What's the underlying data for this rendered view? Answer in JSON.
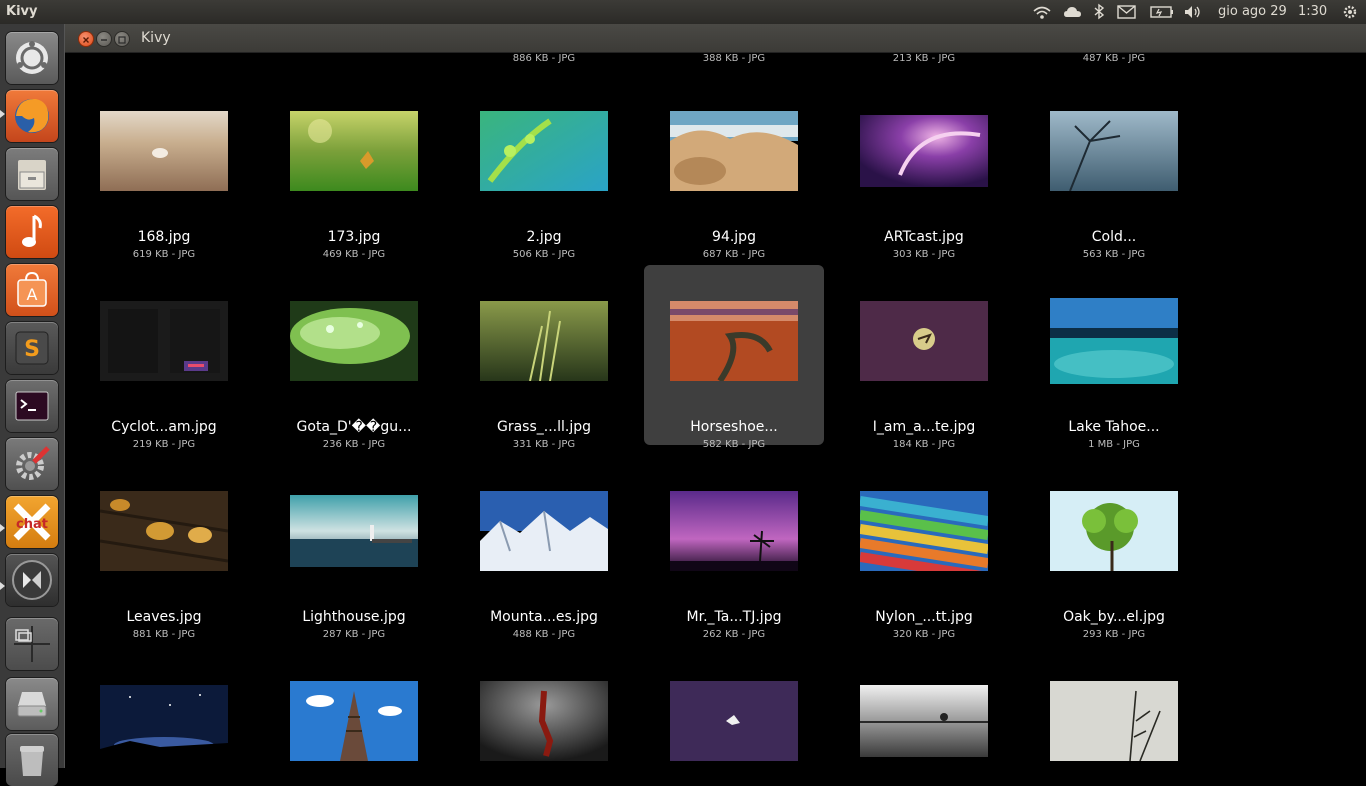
{
  "top_panel": {
    "app_name": "Kivy",
    "date": "gio ago 29",
    "time": "1:30",
    "indicators": [
      "wifi-icon",
      "cloud-icon",
      "bluetooth-icon",
      "mail-icon",
      "battery-icon",
      "volume-icon",
      "gear-icon"
    ]
  },
  "launcher": {
    "items": [
      "ubuntu-logo-icon",
      "firefox-icon",
      "file-manager-icon",
      "music-player-icon",
      "software-center-icon",
      "sublime-text-icon",
      "terminal-icon",
      "system-settings-icon",
      "chat-app-icon",
      "kivy-icon",
      "workspace-switcher-icon",
      "disk-drive-icon",
      "trash-icon"
    ]
  },
  "window": {
    "title": "Kivy"
  },
  "previous_row_meta": [
    "886 KB - JPG",
    "388 KB - JPG",
    "213 KB - JPG",
    "487 KB - JPG"
  ],
  "rows": [
    [
      {
        "name": "168.jpg",
        "meta": "619 KB - JPG"
      },
      {
        "name": "173.jpg",
        "meta": "469 KB - JPG"
      },
      {
        "name": "2.jpg",
        "meta": "506 KB - JPG"
      },
      {
        "name": "94.jpg",
        "meta": "687 KB - JPG"
      },
      {
        "name": "ARTcast.jpg",
        "meta": "303 KB - JPG"
      },
      {
        "name": "Cold...",
        "meta": "563 KB - JPG"
      }
    ],
    [
      {
        "name": "Cyclot...am.jpg",
        "meta": "219 KB - JPG"
      },
      {
        "name": "Gota_D'��gu...",
        "meta": "236 KB - JPG"
      },
      {
        "name": "Grass_...ll.jpg",
        "meta": "331 KB - JPG"
      },
      {
        "name": "Horseshoe...",
        "meta": "582 KB - JPG"
      },
      {
        "name": "I_am_a...te.jpg",
        "meta": "184 KB - JPG"
      },
      {
        "name": "Lake Tahoe...",
        "meta": "1 MB - JPG"
      }
    ],
    [
      {
        "name": "Leaves.jpg",
        "meta": "881 KB - JPG"
      },
      {
        "name": "Lighthouse.jpg",
        "meta": "287 KB - JPG"
      },
      {
        "name": "Mounta...es.jpg",
        "meta": "488 KB - JPG"
      },
      {
        "name": "Mr._Ta...TJ.jpg",
        "meta": "262 KB - JPG"
      },
      {
        "name": "Nylon_...tt.jpg",
        "meta": "320 KB - JPG"
      },
      {
        "name": "Oak_by...el.jpg",
        "meta": "293 KB - JPG"
      }
    ],
    [
      {
        "name": "",
        "meta": ""
      },
      {
        "name": "",
        "meta": ""
      },
      {
        "name": "",
        "meta": ""
      },
      {
        "name": "",
        "meta": ""
      },
      {
        "name": "",
        "meta": ""
      },
      {
        "name": "",
        "meta": ""
      }
    ]
  ],
  "selected_file": "Horseshoe..."
}
